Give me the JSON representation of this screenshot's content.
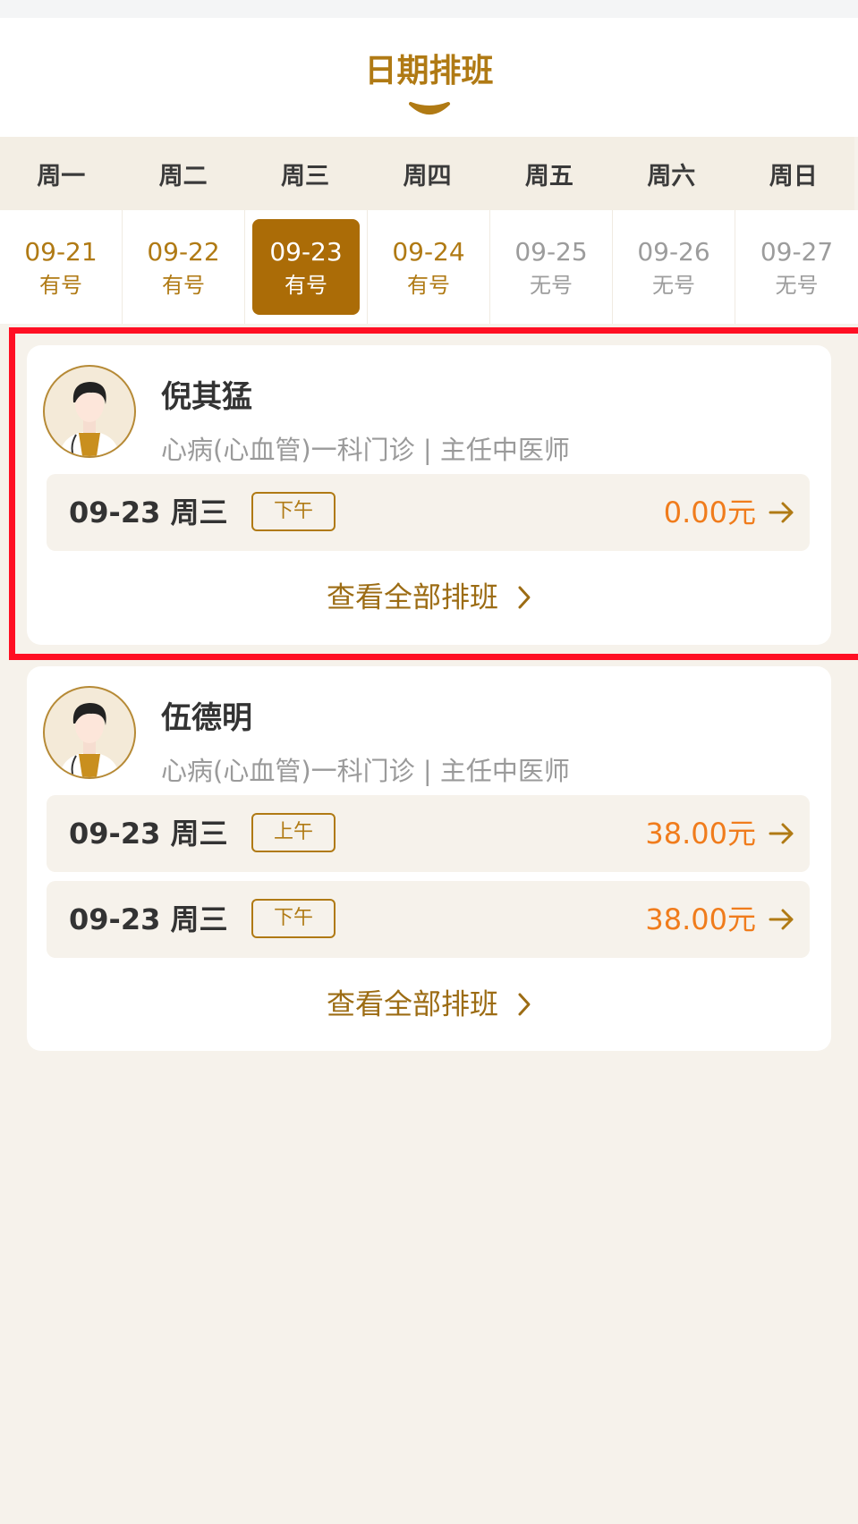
{
  "header": {
    "title": "日期排班"
  },
  "week_days": [
    "周一",
    "周二",
    "周三",
    "周四",
    "周五",
    "周六",
    "周日"
  ],
  "dates": [
    {
      "date": "09-21",
      "status": "有号"
    },
    {
      "date": "09-22",
      "status": "有号"
    },
    {
      "date": "09-23",
      "status": "有号"
    },
    {
      "date": "09-24",
      "status": "有号"
    },
    {
      "date": "09-25",
      "status": "无号"
    },
    {
      "date": "09-26",
      "status": "无号"
    },
    {
      "date": "09-27",
      "status": "无号"
    }
  ],
  "doctors": [
    {
      "name": "倪其猛",
      "dept": "心病(心血管)一科门诊 | 主任中医师",
      "slots": [
        {
          "date": "09-23 周三",
          "period": "下午",
          "price": "0.00元"
        }
      ],
      "view_all": "查看全部排班"
    },
    {
      "name": "伍德明",
      "dept": "心病(心血管)一科门诊 | 主任中医师",
      "slots": [
        {
          "date": "09-23 周三",
          "period": "上午",
          "price": "38.00元"
        },
        {
          "date": "09-23 周三",
          "period": "下午",
          "price": "38.00元"
        }
      ],
      "view_all": "查看全部排班"
    }
  ],
  "colors": {
    "brand": "#b07a14",
    "selected_bg": "#ab6c07",
    "price": "#f07c1c",
    "page_bg": "#f6f2eb",
    "highlight": "#ff0f23"
  },
  "icons": {
    "title_decoration": "smile-curve-icon",
    "slot_arrow": "arrow-right-icon",
    "view_all": "chevron-right-icon",
    "avatar": "doctor-avatar-icon"
  }
}
